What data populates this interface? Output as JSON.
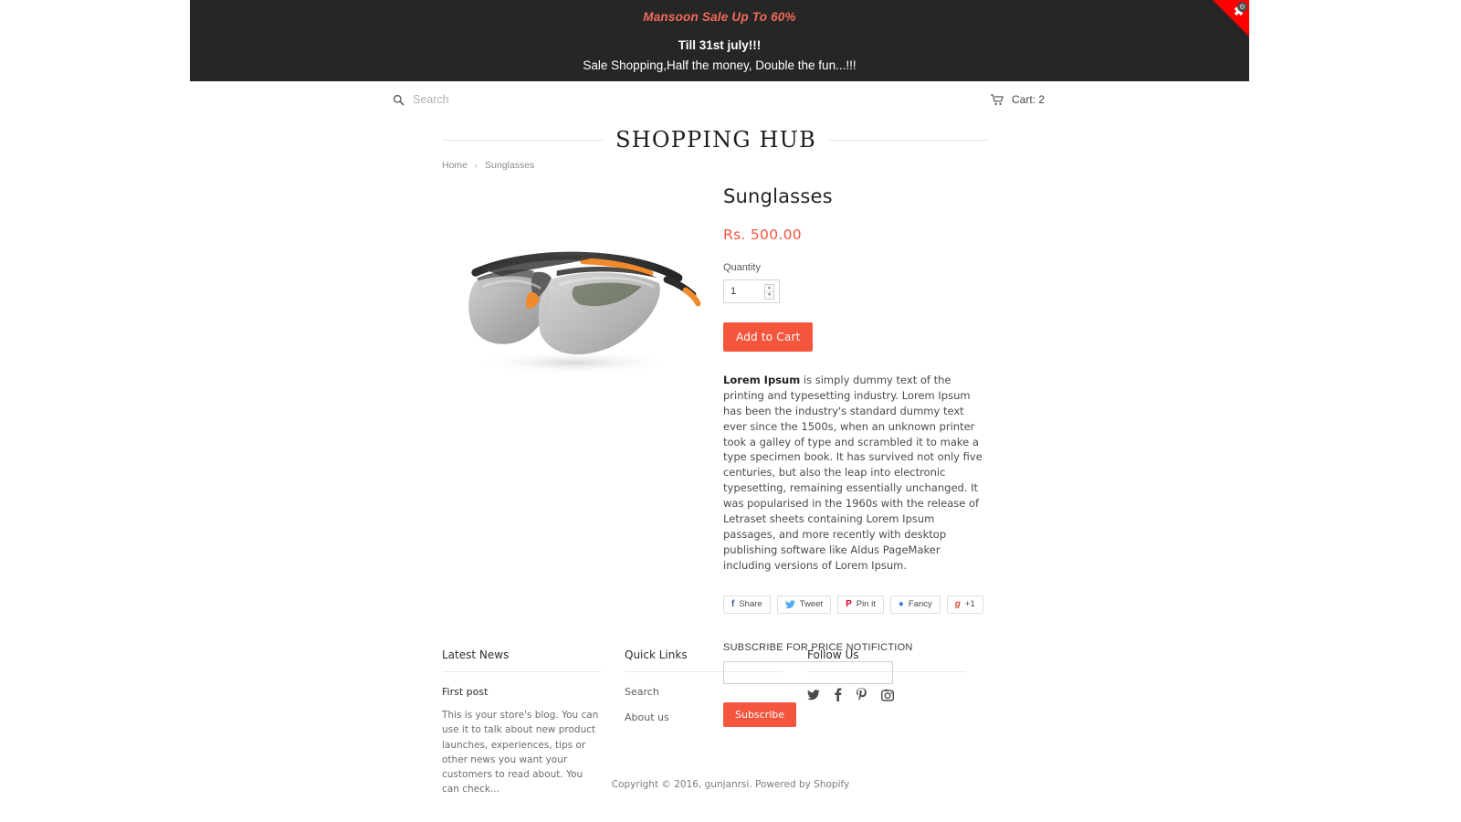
{
  "promo": {
    "line1_prefix": "Mansoon Sale Up To ",
    "line1_percent": "60%",
    "line2": "Till 31st july!!!",
    "line3": "Sale Shopping,Half the money, Double the fun...!!!",
    "close_glyph": "✖",
    "gear_glyph": "⚙",
    "background": "#262626",
    "accent": "#f26a5a",
    "close_color": "#fe0000"
  },
  "header": {
    "search_placeholder": "Search",
    "search_value": "",
    "cart_label": "Cart: 2",
    "logo": "SHOPPING HUB"
  },
  "breadcrumb": {
    "home": "Home",
    "separator": "›",
    "current": "Sunglasses"
  },
  "product": {
    "title": "Sunglasses",
    "price": "Rs. 500.00",
    "quantity_label": "Quantity",
    "quantity_value": "1",
    "spin_up": "▲",
    "spin_down": "▼",
    "add_to_cart": "Add to Cart",
    "desc_lead": "Lorem Ipsum",
    "desc_body": " is simply dummy text of the printing and typesetting industry. Lorem Ipsum has been the industry's standard dummy text ever since the 1500s, when an unknown printer took a galley of type and scrambled it to make a type specimen book. It has survived not only five centuries, but also the leap into electronic typesetting, remaining essentially unchanged. It was popularised in the 1960s with the release of Letraset sheets containing Lorem Ipsum passages, and more recently with desktop publishing software like Aldus PageMaker including versions of Lorem Ipsum.",
    "accent_color": "#f4553d"
  },
  "share_buttons": [
    {
      "label": "Share",
      "glyph": "f",
      "color": "#3b5998",
      "icon": "facebook-icon"
    },
    {
      "label": "Tweet",
      "glyph": "🐦",
      "color": "#3cf",
      "icon": "twitter-icon"
    },
    {
      "label": "Pin it",
      "glyph": "P",
      "color": "#e60023",
      "icon": "pinterest-icon"
    },
    {
      "label": "Fancy",
      "glyph": "●",
      "color": "#3b7fd4",
      "icon": "fancy-icon"
    },
    {
      "label": "+1",
      "glyph": "g",
      "color": "#dd4b39",
      "icon": "googleplus-icon"
    }
  ],
  "subscribe": {
    "title": "SUBSCRIBE FOR PRICE NOTIFICTION",
    "input_value": "",
    "input_placeholder": "",
    "button": "Subscribe"
  },
  "footer": {
    "columns": [
      {
        "title": "Latest News",
        "post_title": "First post",
        "post_body": "This is your store's blog. You can use it to talk about new product launches, experiences, tips or other news you want your customers to read about. You can check..."
      },
      {
        "title": "Quick Links",
        "links": [
          "Search",
          "About us"
        ]
      },
      {
        "title": "Follow Us",
        "social": [
          "twitter-icon",
          "facebook-icon",
          "pinterest-icon",
          "instagram-icon"
        ]
      }
    ],
    "copyright": "Copyright © 2016, gunjanrsi. Powered by Shopify"
  }
}
